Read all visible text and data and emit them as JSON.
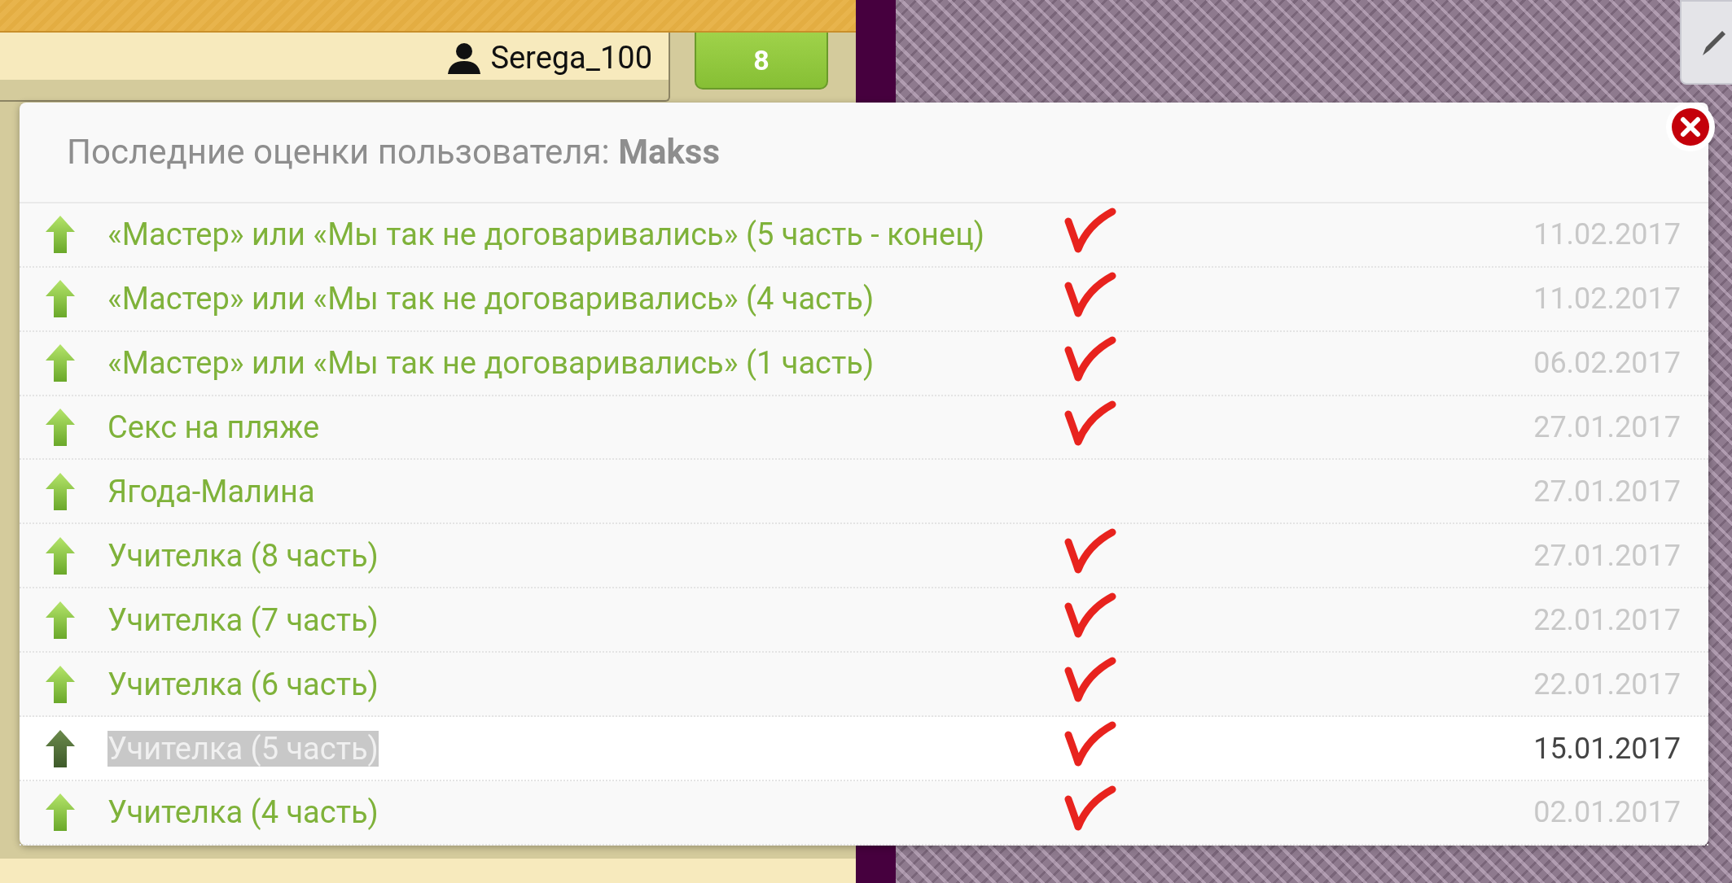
{
  "header": {
    "username": "Serega_100",
    "badge": "8"
  },
  "dialog": {
    "title_prefix": "Последние оценки пользователя: ",
    "title_user": "Makss",
    "rows": [
      {
        "title": "«Мастер» или «Мы так не договаривались» (5 часть - конец)",
        "date": "11.02.2017",
        "selected": false,
        "marked": true
      },
      {
        "title": "«Мастер» или «Мы так не договаривались» (4 часть)",
        "date": "11.02.2017",
        "selected": false,
        "marked": true
      },
      {
        "title": "«Мастер» или «Мы так не договаривались» (1 часть)",
        "date": "06.02.2017",
        "selected": false,
        "marked": true
      },
      {
        "title": "Секс на пляже",
        "date": "27.01.2017",
        "selected": false,
        "marked": true
      },
      {
        "title": "Ягода-Малина",
        "date": "27.01.2017",
        "selected": false,
        "marked": false
      },
      {
        "title": "Учителка (8 часть)",
        "date": "27.01.2017",
        "selected": false,
        "marked": true
      },
      {
        "title": "Учителка (7 часть)",
        "date": "22.01.2017",
        "selected": false,
        "marked": true
      },
      {
        "title": "Учителка (6 часть)",
        "date": "22.01.2017",
        "selected": false,
        "marked": true
      },
      {
        "title": "Учителка (5 часть)",
        "date": "15.01.2017",
        "selected": true,
        "marked": true
      },
      {
        "title": "Учителка (4 часть)",
        "date": "02.01.2017",
        "selected": false,
        "marked": true
      }
    ]
  }
}
